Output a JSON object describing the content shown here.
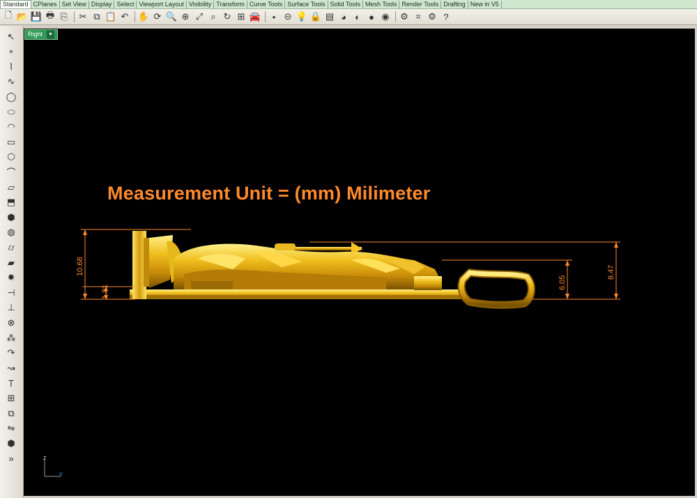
{
  "tabs": [
    "Standard",
    "CPlanes",
    "Set View",
    "Display",
    "Select",
    "Viewport Layout",
    "Visibility",
    "Transform",
    "Curve Tools",
    "Surface Tools",
    "Solid Tools",
    "Mesh Tools",
    "Render Tools",
    "Drafting",
    "New in V5"
  ],
  "toolbar_icons": [
    "new-icon",
    "open-icon",
    "save-icon",
    "print-icon",
    "import-icon",
    "cut-icon",
    "copy-icon",
    "paste-icon",
    "undo-icon",
    "pan-icon",
    "rotate-icon",
    "zoom-icon",
    "zoom-window-icon",
    "zoom-extents-icon",
    "zoom-selected-icon",
    "rotate-view-icon",
    "viewport-layout-icon",
    "car-icon",
    "point-icon",
    "line-icon",
    "lightbulb-icon",
    "lock-icon",
    "layer-icon",
    "color-wheel-icon",
    "material-icon",
    "render-sphere-icon",
    "render-icon",
    "options-icon",
    "snap-icon",
    "gear-icon",
    "help-icon"
  ],
  "left_icons": [
    "select-arrow-icon",
    "point-icon",
    "polyline-icon",
    "curve-icon",
    "circle-icon",
    "ellipse-icon",
    "arc-icon",
    "rectangle-icon",
    "polygon-icon",
    "fillet-icon",
    "surface-icon",
    "extrude-icon",
    "box-icon",
    "sphere-icon",
    "cylinder-icon",
    "plane-icon",
    "explode-icon",
    "trim-icon",
    "split-icon",
    "boolean-icon",
    "group-icon",
    "rotate-icon",
    "move-icon",
    "text-icon",
    "array-icon",
    "block-icon",
    "mirror-icon",
    "cage-icon",
    "more-icon"
  ],
  "viewport": {
    "label": "Right",
    "title": "Measurement Unit = (mm) Milimeter",
    "dimensions": {
      "height_total": "10.68",
      "base": "1.81",
      "loop_inner": "6.05",
      "loop_outer": "8.47"
    },
    "axis_z": "z",
    "axis_y": "y"
  },
  "colors": {
    "accent": "#ff8a2c",
    "gold": "#d6a50c",
    "viewport_tab": "#2f9a56",
    "background": "#000000"
  }
}
